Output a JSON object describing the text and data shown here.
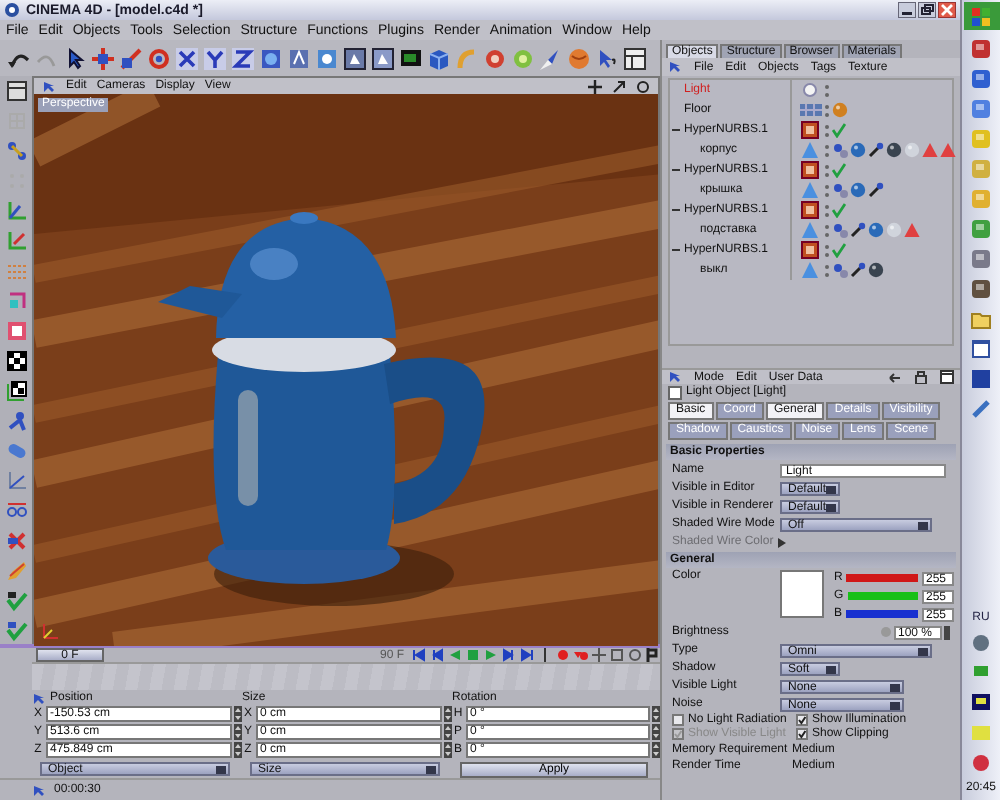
{
  "window": {
    "title": "CINEMA 4D - [model.c4d *]"
  },
  "menu": [
    "File",
    "Edit",
    "Objects",
    "Tools",
    "Selection",
    "Structure",
    "Functions",
    "Plugins",
    "Render",
    "Animation",
    "Window",
    "Help"
  ],
  "viewport": {
    "menu": [
      "Edit",
      "Cameras",
      "Display",
      "View"
    ],
    "camera": "Perspective"
  },
  "timeline": {
    "current": "0 F",
    "end": "90 F"
  },
  "coordinates": {
    "columns": [
      {
        "title": "Position",
        "fields": [
          {
            "axis": "X",
            "value": "-150.53 cm"
          },
          {
            "axis": "Y",
            "value": "513.6 cm"
          },
          {
            "axis": "Z",
            "value": "475.849 cm"
          }
        ],
        "footer": {
          "kind": "select",
          "text": "Object"
        }
      },
      {
        "title": "Size",
        "fields": [
          {
            "axis": "X",
            "value": "0 cm"
          },
          {
            "axis": "Y",
            "value": "0 cm"
          },
          {
            "axis": "Z",
            "value": "0 cm"
          }
        ],
        "footer": {
          "kind": "select",
          "text": "Size"
        }
      },
      {
        "title": "Rotation",
        "fields": [
          {
            "axis": "H",
            "value": "0 °"
          },
          {
            "axis": "P",
            "value": "0 °"
          },
          {
            "axis": "B",
            "value": "0 °"
          }
        ],
        "footer": {
          "kind": "button",
          "text": "Apply"
        }
      }
    ]
  },
  "status": "00:00:30",
  "objects": {
    "tabs": [
      {
        "label": "Objects",
        "selected": true
      },
      {
        "label": "Structure",
        "selected": false
      },
      {
        "label": "Browser",
        "selected": false
      },
      {
        "label": "Materials",
        "selected": false
      }
    ],
    "menu": [
      "File",
      "Edit",
      "Objects",
      "Tags",
      "Texture"
    ],
    "tree": [
      {
        "name": "Light",
        "kind": "light",
        "selected": true
      },
      {
        "name": "Floor",
        "kind": "floor",
        "selected": false
      },
      {
        "name": "HyperNURBS.1",
        "kind": "hypernurbs",
        "selected": false,
        "expanded": true,
        "children": [
          {
            "name": "корпус",
            "kind": "polygon",
            "selected": false
          }
        ]
      },
      {
        "name": "HyperNURBS.1",
        "kind": "hypernurbs",
        "selected": false,
        "expanded": true,
        "children": [
          {
            "name": "крышка",
            "kind": "polygon",
            "selected": false
          }
        ]
      },
      {
        "name": "HyperNURBS.1",
        "kind": "hypernurbs",
        "selected": false,
        "expanded": true,
        "children": [
          {
            "name": "подставка",
            "kind": "polygon",
            "selected": false
          }
        ]
      },
      {
        "name": "HyperNURBS.1",
        "kind": "hypernurbs",
        "selected": false,
        "expanded": true,
        "children": [
          {
            "name": "выкл",
            "kind": "polygon",
            "selected": false
          }
        ]
      }
    ]
  },
  "attributes": {
    "menu": [
      "Mode",
      "Edit",
      "User Data"
    ],
    "title": "Light Object [Light]",
    "tabs": [
      {
        "label": "Basic",
        "selected": true
      },
      {
        "label": "Coord",
        "selected": false
      },
      {
        "label": "General",
        "selected": true
      },
      {
        "label": "Details",
        "selected": false
      },
      {
        "label": "Visibility",
        "selected": false
      },
      {
        "label": "Shadow",
        "selected": false
      },
      {
        "label": "Caustics",
        "selected": false
      },
      {
        "label": "Noise",
        "selected": false
      },
      {
        "label": "Lens",
        "selected": false
      },
      {
        "label": "Scene",
        "selected": false
      }
    ],
    "sections": [
      {
        "title": "Basic Properties",
        "rows": [
          {
            "kind": "text",
            "label": "Name",
            "value": "Light",
            "disabled": false
          },
          {
            "kind": "select",
            "label": "Visible in Editor",
            "value": "Default",
            "disabled": false
          },
          {
            "kind": "select",
            "label": "Visible in Renderer",
            "value": "Default",
            "disabled": false
          },
          {
            "kind": "wide-select",
            "label": "Shaded Wire Mode",
            "value": "Off",
            "disabled": false
          },
          {
            "kind": "label",
            "label": "Shaded Wire Color",
            "disabled": true
          }
        ]
      },
      {
        "title": "General",
        "rows": [
          {
            "kind": "color",
            "label": "Color",
            "disabled": false,
            "channels": [
              {
                "name": "R",
                "level": 1,
                "value": "255",
                "color": "#d01818"
              },
              {
                "name": "G",
                "level": 1,
                "value": "255",
                "color": "#18c018"
              },
              {
                "name": "B",
                "level": 1,
                "value": "255",
                "color": "#1830d0"
              }
            ]
          },
          {
            "kind": "number",
            "label": "Brightness",
            "value": "100 %",
            "disabled": false
          },
          {
            "kind": "wide-select",
            "label": "Type",
            "value": "Omni",
            "disabled": false
          },
          {
            "kind": "select",
            "label": "Shadow",
            "value": "Soft",
            "disabled": false
          },
          {
            "kind": "mid-select",
            "label": "Visible Light",
            "value": "None",
            "disabled": false
          },
          {
            "kind": "mid-select",
            "label": "Noise",
            "value": "None",
            "disabled": false
          },
          {
            "kind": "checks",
            "disabled": false,
            "items": [
              {
                "label": "No Light Radiation",
                "checked": false,
                "disabled": false
              },
              {
                "label": "Show Illumination",
                "checked": true,
                "disabled": false
              }
            ]
          },
          {
            "kind": "checks",
            "disabled": false,
            "items": [
              {
                "label": "Show Visible Light",
                "checked": true,
                "disabled": true
              },
              {
                "label": "Show Clipping",
                "checked": true,
                "disabled": false
              }
            ]
          },
          {
            "kind": "info",
            "label": "Memory Requirement",
            "value": "Medium",
            "disabled": false
          },
          {
            "kind": "info",
            "label": "Render Time",
            "value": "Medium",
            "disabled": false
          }
        ]
      }
    ]
  },
  "taskbar": {
    "language": "RU",
    "clock": "20:45"
  }
}
